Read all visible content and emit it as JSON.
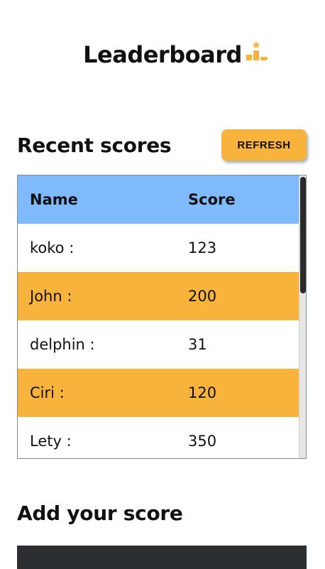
{
  "header": {
    "title": "Leaderboard",
    "icon": "podium-star-icon",
    "accent_color": "#f8b33d"
  },
  "recent": {
    "title": "Recent scores",
    "refresh_label": "REFRESH"
  },
  "table": {
    "columns": [
      "Name",
      "Score"
    ],
    "header_color": "#7fbafd",
    "alt_row_color": "#f8b33d",
    "rows": [
      {
        "name": "koko :",
        "score": "123"
      },
      {
        "name": "John :",
        "score": "200"
      },
      {
        "name": "delphin :",
        "score": "31"
      },
      {
        "name": "Ciri :",
        "score": "120"
      },
      {
        "name": "Lety :",
        "score": "350"
      }
    ]
  },
  "add": {
    "title": "Add your score",
    "form_color": "#2b2f31"
  }
}
